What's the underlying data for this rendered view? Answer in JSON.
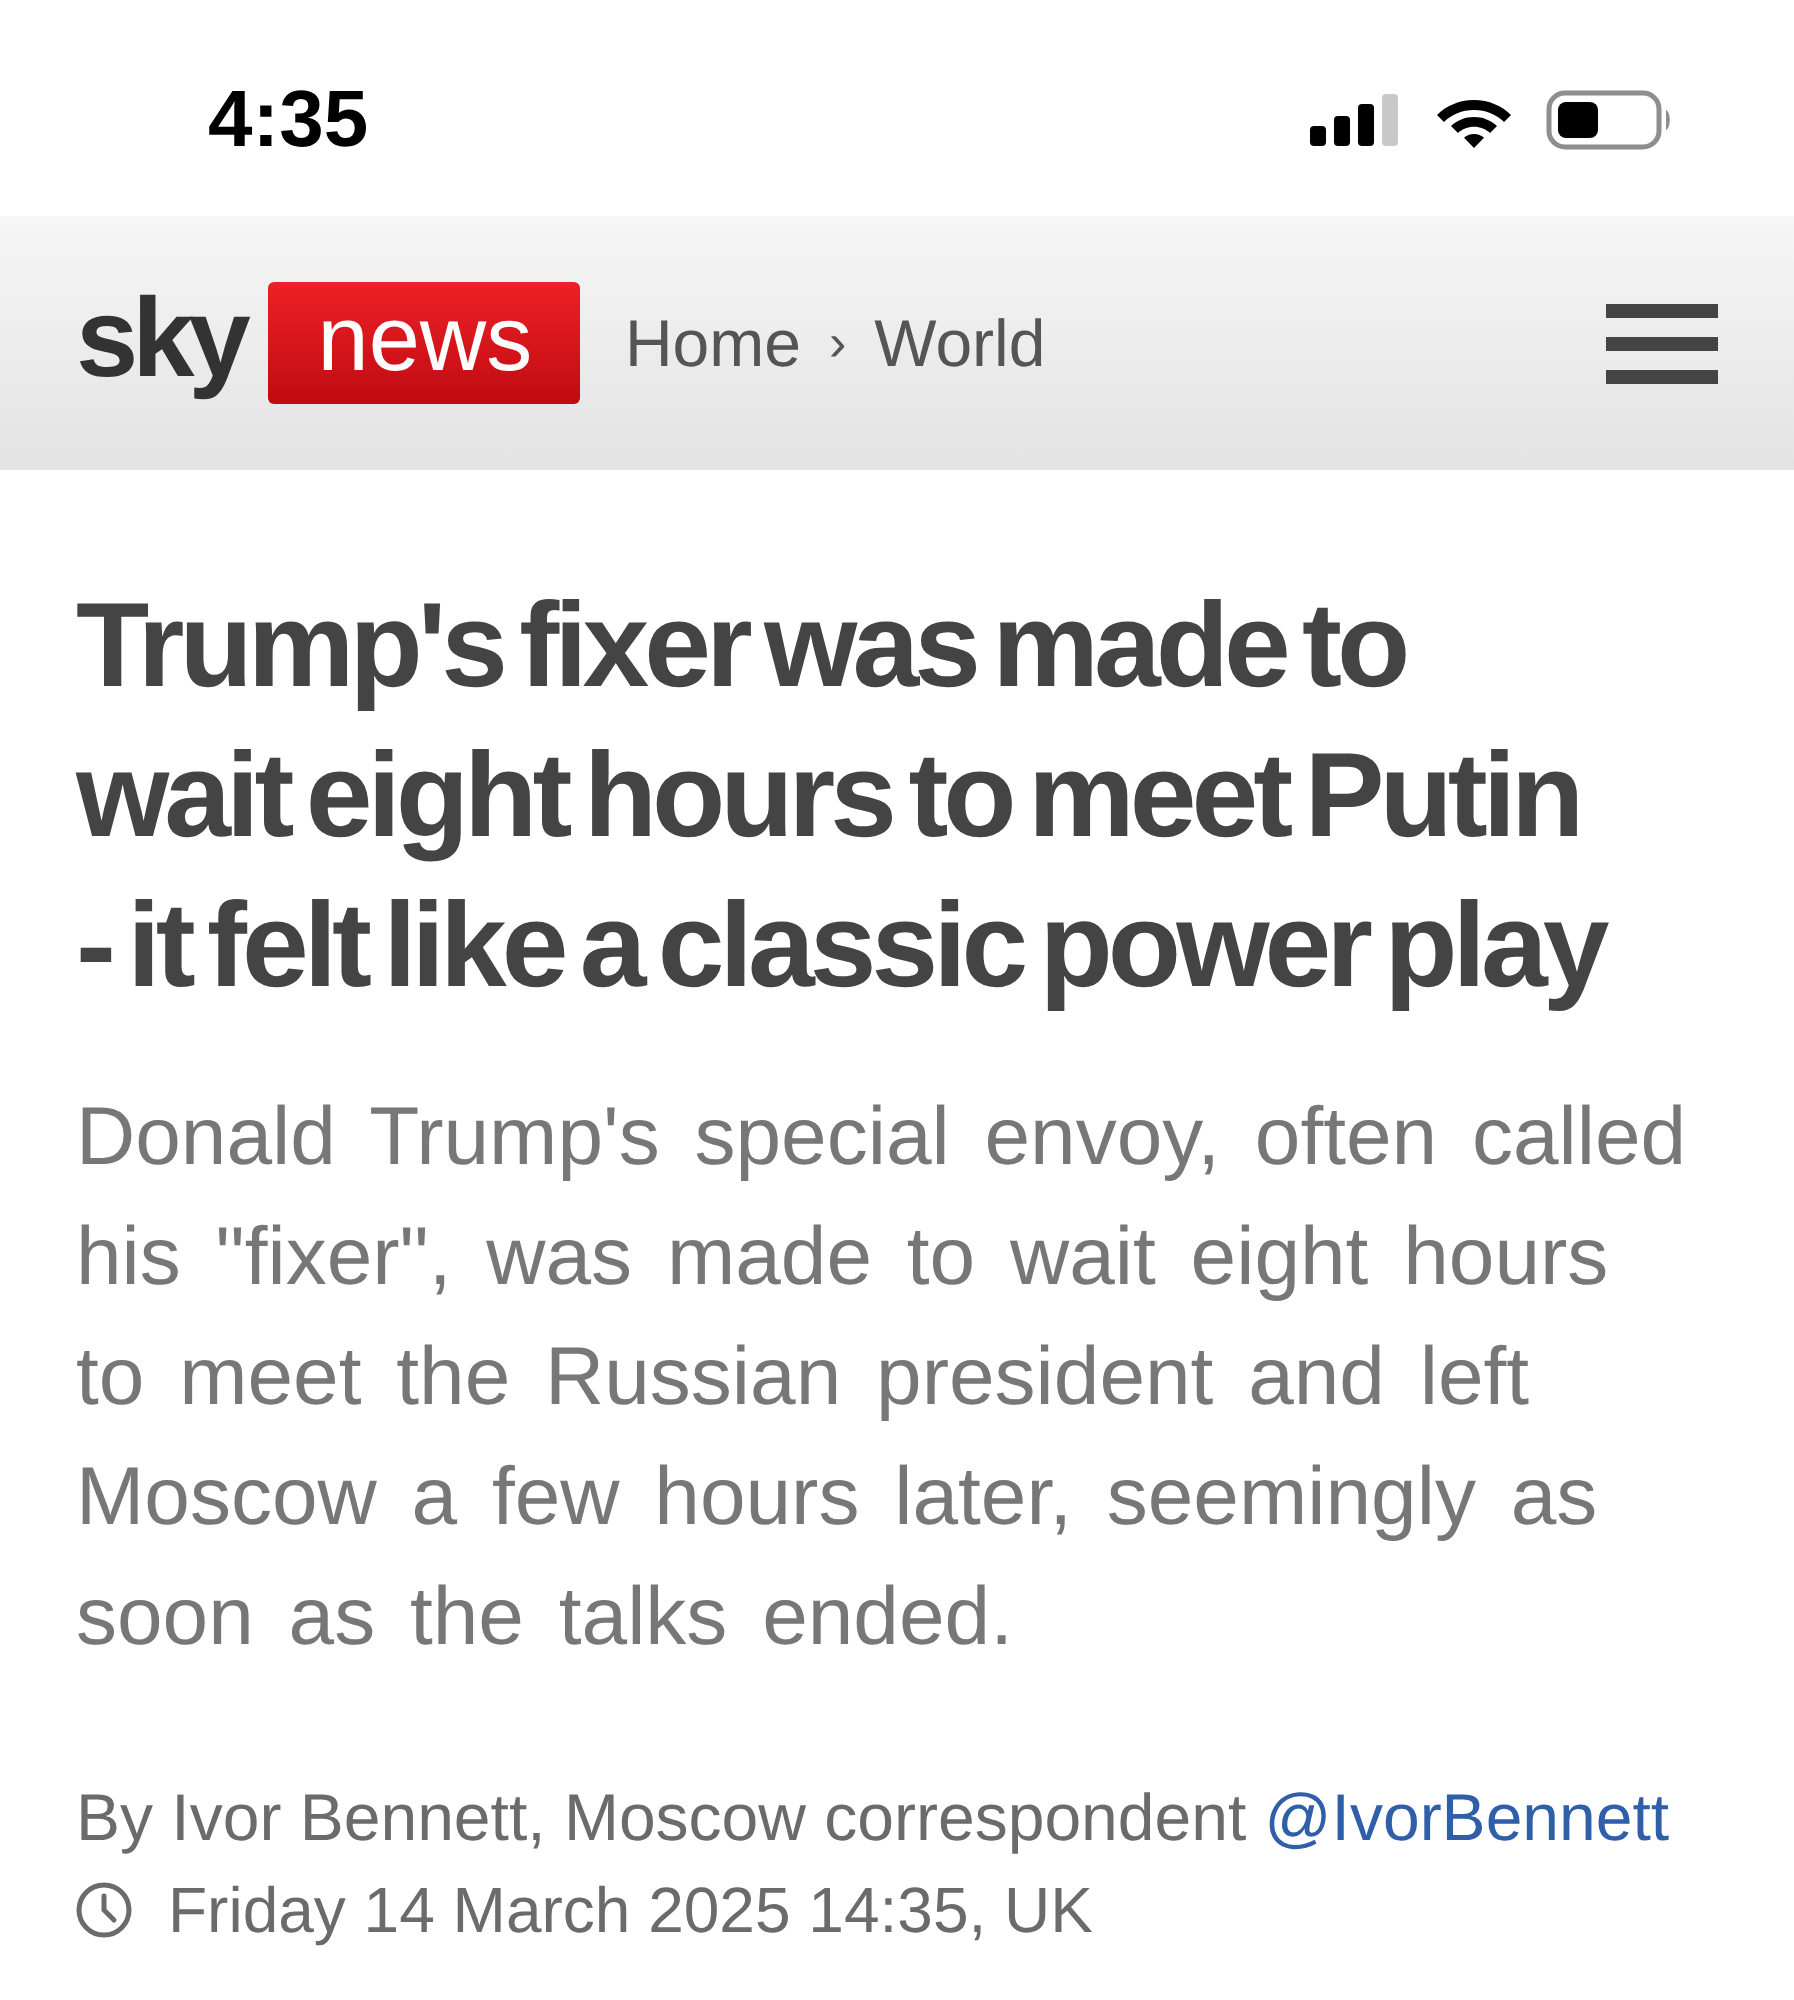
{
  "status_bar": {
    "time": "4:35"
  },
  "header": {
    "logo": {
      "sky": "sky",
      "news": "news"
    },
    "breadcrumb": {
      "items": [
        {
          "label": "Home"
        },
        {
          "label": "World"
        }
      ],
      "separator": "›"
    }
  },
  "article": {
    "headline": "Trump's fixer was made to wait eight hours to meet Putin - it felt like a classic power play",
    "summary": "Donald Trump's special envoy, often called his \"fixer\", was made to wait eight hours to meet the Russian president and left Moscow a few hours later, seemingly as soon as the talks ended.",
    "byline": {
      "text": "By Ivor Bennett, Moscow correspondent",
      "handle": "@IvorBennett"
    },
    "date": "Friday 14 March 2025 14:35, UK"
  }
}
